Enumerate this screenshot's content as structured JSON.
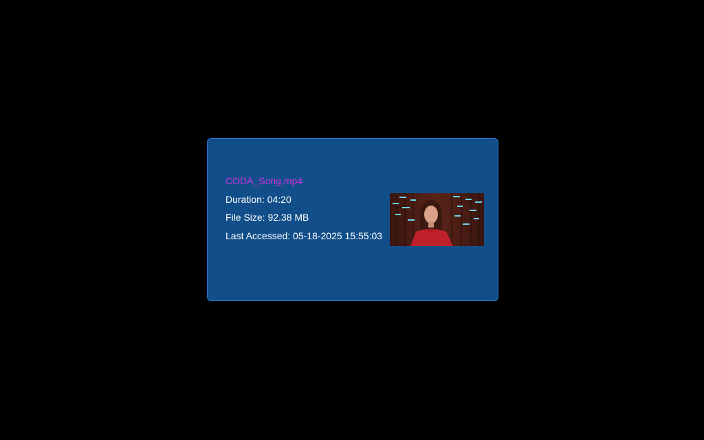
{
  "file": {
    "name": "CODA_Song.mp4",
    "duration": "Duration: 04:20",
    "size": "File Size: 92.38 MB",
    "last_accessed": "Last Accessed: 05-18-2025 15:55:03"
  },
  "colors": {
    "background": "#000000",
    "card": "#124f8a",
    "card_border": "#2a7ad0",
    "file_name": "#d030e0",
    "text": "#ffffff"
  },
  "icons": {
    "thumbnail": "video-thumbnail"
  }
}
